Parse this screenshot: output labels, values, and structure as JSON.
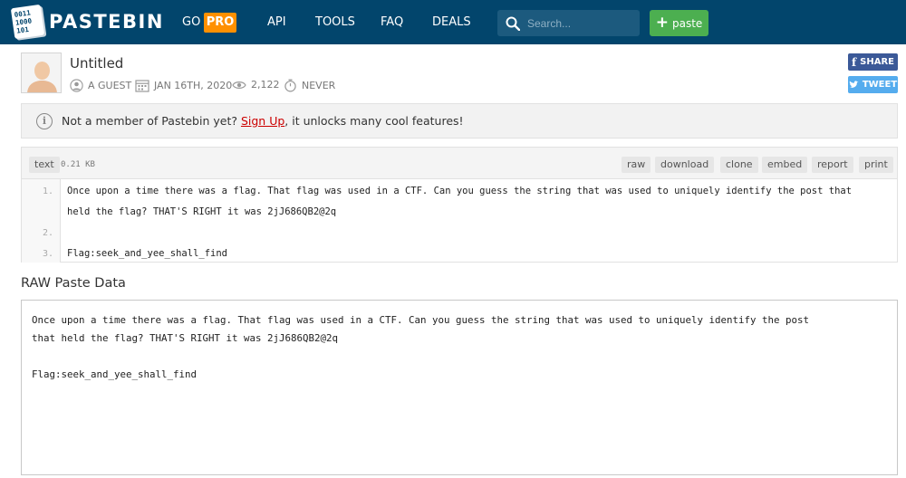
{
  "header": {
    "logo_text": "PASTEBIN",
    "logo_bits": [
      "0011",
      "1000",
      "101"
    ],
    "nav": {
      "go": "GO",
      "pro": "PRO",
      "api": "API",
      "tools": "TOOLS",
      "faq": "FAQ",
      "deals": "DEALS"
    },
    "search_placeholder": "Search...",
    "paste_button": "paste"
  },
  "paste": {
    "title": "Untitled",
    "author": "A GUEST",
    "date": "JAN 16TH, 2020",
    "views": "2,122",
    "expiry": "NEVER"
  },
  "social": {
    "share": "SHARE",
    "tweet": "TWEET"
  },
  "notice": {
    "before": "Not a member of Pastebin yet? ",
    "link": "Sign Up",
    "after": ", it unlocks many cool features!"
  },
  "code": {
    "syntax": "text",
    "size": "0.21 KB",
    "actions": {
      "raw": "raw",
      "download": "download",
      "clone": "clone",
      "embed": "embed",
      "report": "report",
      "print": "print"
    },
    "line_numbers": [
      "1.",
      "2.",
      "3."
    ],
    "lines": [
      "Once upon a time there was a flag. That flag was used in a CTF. Can you guess the string that was used to uniquely identify the post that",
      "held the flag? THAT'S RIGHT it was 2jJ686QB2@2q",
      "",
      "Flag:seek_and_yee_shall_find"
    ]
  },
  "raw": {
    "heading": "RAW Paste Data",
    "content": "Once upon a time there was a flag. That flag was used in a CTF. Can you guess the string that was used to uniquely identify the post\nthat held the flag? THAT'S RIGHT it was 2jJ686QB2@2q\n\nFlag:seek_and_yee_shall_find"
  },
  "colors": {
    "header_bg": "#02456c",
    "pro_badge": "#ff9000",
    "paste_button": "#4caf50",
    "facebook": "#3b5998",
    "twitter": "#55acee",
    "signup_link": "#cc0000"
  }
}
